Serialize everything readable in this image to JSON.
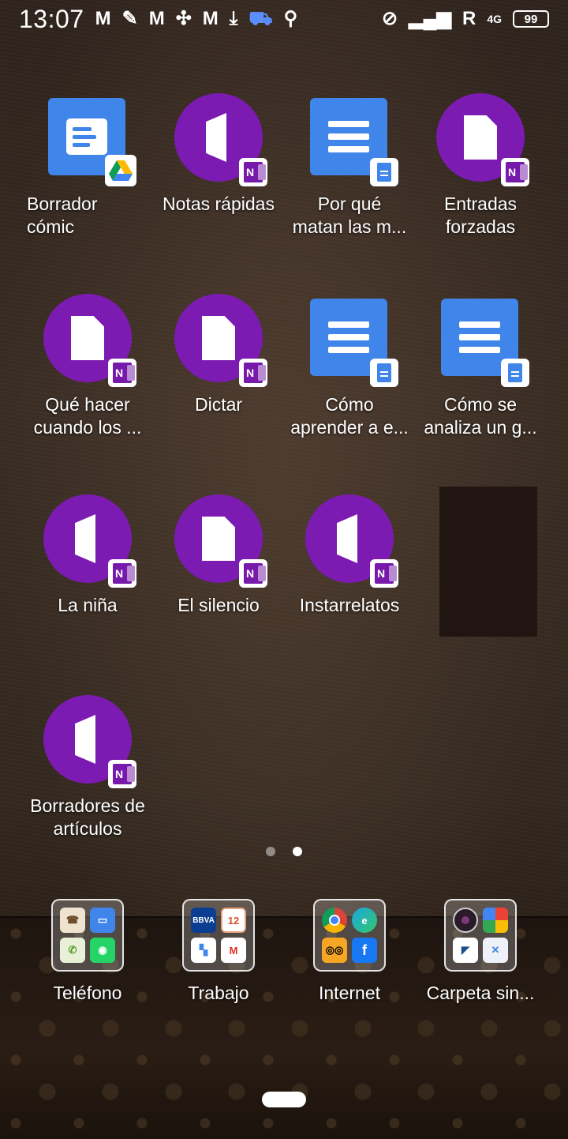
{
  "status_bar": {
    "time": "13:07",
    "roaming": "R",
    "network": "4G",
    "battery": "99"
  },
  "apps": [
    {
      "label": "Borrador\ncómic",
      "icon": "google-drive-doc-shortcut",
      "align": "left"
    },
    {
      "label": "Notas rápidas",
      "icon": "onenote-notebook-shortcut"
    },
    {
      "label": "Por qué\nmatan las m...",
      "icon": "google-docs-shortcut"
    },
    {
      "label": "Entradas\nforzadas",
      "icon": "onenote-page-shortcut"
    },
    {
      "label": "Qué hacer\ncuando los ...",
      "icon": "onenote-page-shortcut"
    },
    {
      "label": "Dictar",
      "icon": "onenote-page-shortcut"
    },
    {
      "label": "Cómo\naprender a e...",
      "icon": "google-docs-shortcut"
    },
    {
      "label": "Cómo se\nanaliza un g...",
      "icon": "google-docs-shortcut"
    },
    {
      "label": "La niña",
      "icon": "onenote-notebook-shortcut"
    },
    {
      "label": "El silencio",
      "icon": "onenote-page-shortcut"
    },
    {
      "label": "Instarrelatos",
      "icon": "onenote-notebook-shortcut"
    },
    {
      "label": "",
      "icon": "empty"
    },
    {
      "label": "Borradores de\nartículos",
      "icon": "onenote-notebook-shortcut"
    }
  ],
  "page_indicator": {
    "pages": 2,
    "current": 2
  },
  "dock": [
    {
      "label": "Teléfono",
      "apps": [
        "contacts",
        "messages",
        "phone",
        "whatsapp"
      ]
    },
    {
      "label": "Trabajo",
      "apps": [
        "bbva",
        "calendar",
        "files",
        "gmail"
      ],
      "mini_text": {
        "bbva": "BBVA",
        "calendar": "12"
      }
    },
    {
      "label": "Internet",
      "apps": [
        "chrome",
        "edge",
        "tripadvisor",
        "facebook"
      ]
    },
    {
      "label": "Carpeta sin...",
      "apps": [
        "camera",
        "photos",
        "scanner",
        "tools"
      ]
    }
  ],
  "colors": {
    "onenote_purple": "#7c1bb2",
    "docs_blue": "#3f85ea"
  }
}
